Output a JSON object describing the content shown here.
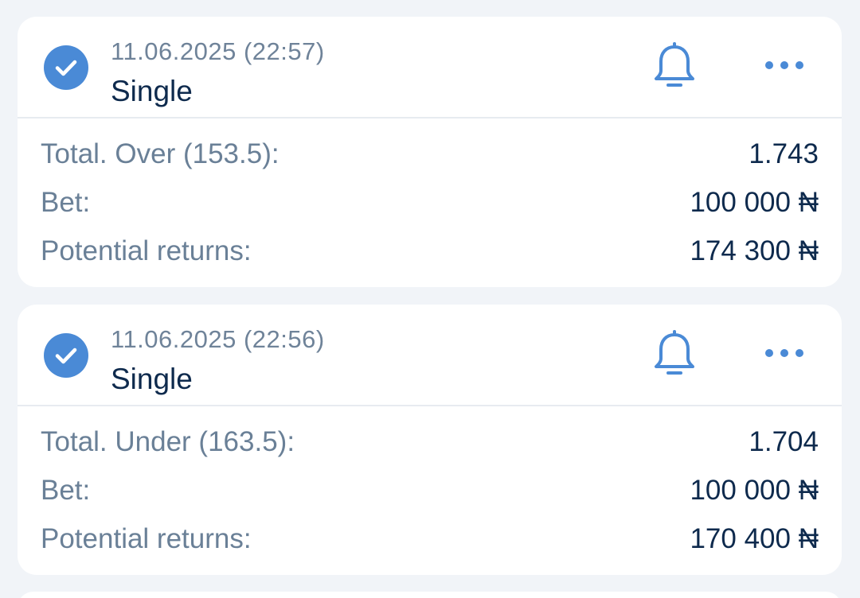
{
  "colors": {
    "accent": "#4a8ad6",
    "label_text": "#6a8097",
    "value_text": "#0e2a4d",
    "background": "#f1f4f8",
    "card": "#ffffff"
  },
  "bets": [
    {
      "status_icon": "check-circle-icon",
      "date": "11.06.2025 (22:57)",
      "type": "Single",
      "market_label": "Total. Over (153.5):",
      "odds": "1.743",
      "bet_label": "Bet:",
      "bet_amount": "100 000 ₦",
      "returns_label": "Potential returns:",
      "returns_amount": "174 300 ₦"
    },
    {
      "status_icon": "check-circle-icon",
      "date": "11.06.2025 (22:56)",
      "type": "Single",
      "market_label": "Total. Under (163.5):",
      "odds": "1.704",
      "bet_label": "Bet:",
      "bet_amount": "100 000 ₦",
      "returns_label": "Potential returns:",
      "returns_amount": "170 400 ₦"
    }
  ]
}
